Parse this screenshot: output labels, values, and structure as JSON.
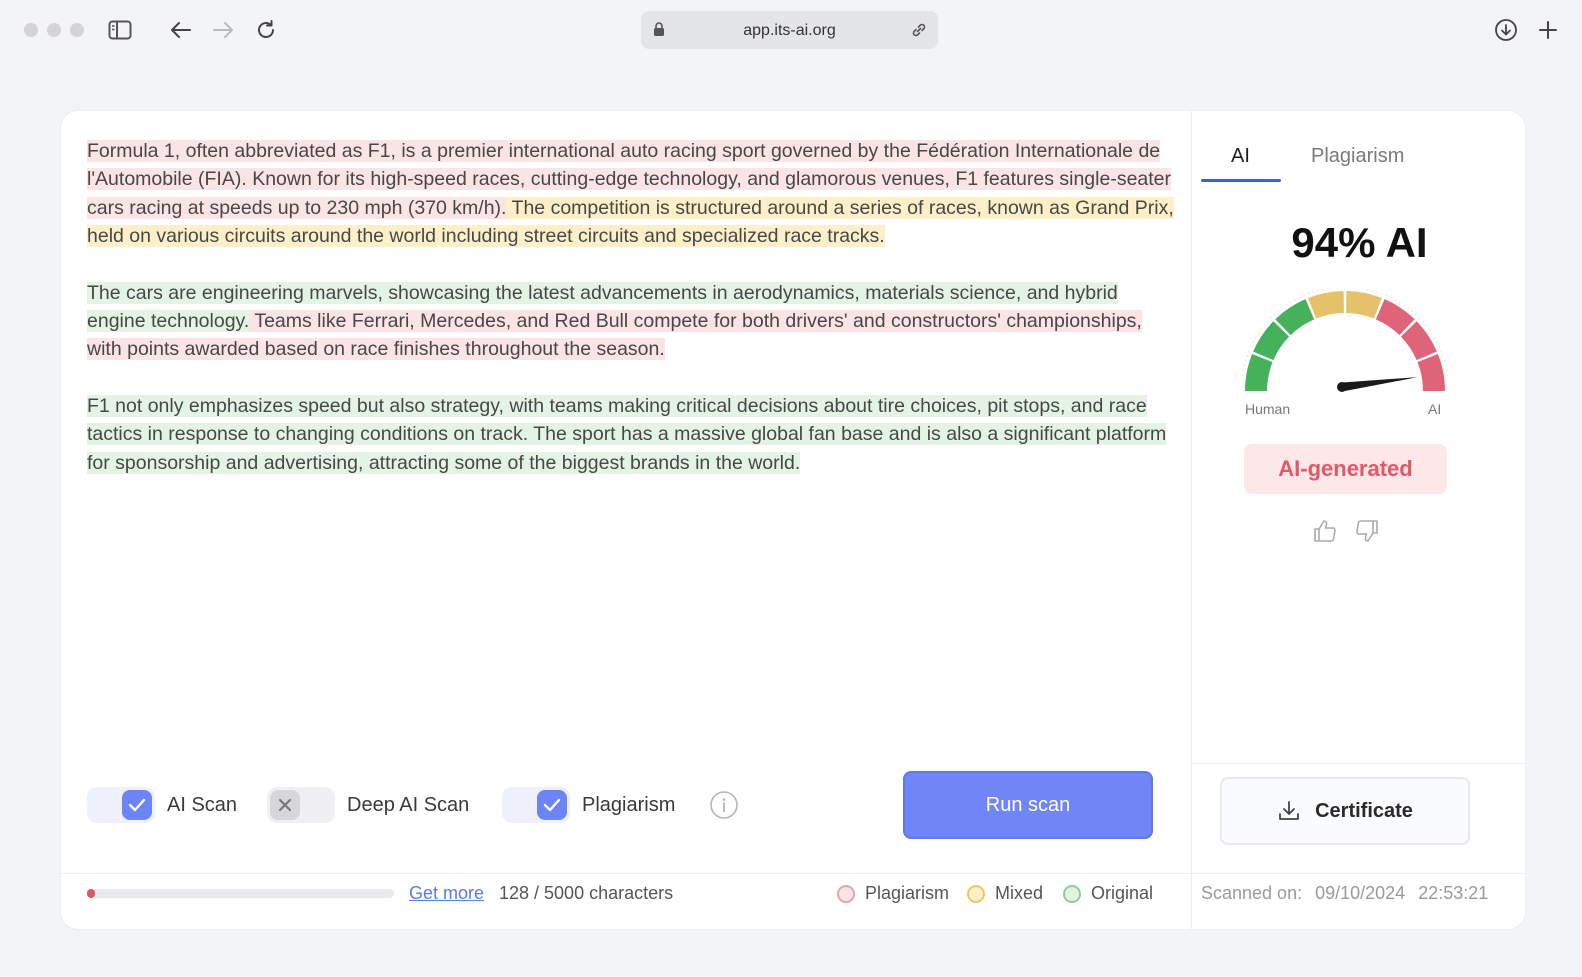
{
  "browser": {
    "url": "app.its-ai.org"
  },
  "editor": {
    "paragraphs": [
      [
        {
          "type": "plagiarism",
          "text": "Formula 1, often abbreviated as F1, is a premier international auto racing sport governed by the Fédération Internationale de l'Automobile (FIA). Known for its high-speed races, cutting-edge technology, and glamorous venues, F1 features single-seater cars racing at speeds up to 230 mph (370 km/h)."
        },
        {
          "type": "mixed",
          "text": " The competition is structured around a series of races, known as Grand Prix, held on various circuits around the world including street circuits and specialized race tracks."
        }
      ],
      [
        {
          "type": "original",
          "text": "The cars are engineering marvels, showcasing the latest advancements in aerodynamics, materials science, and hybrid engine technology."
        },
        {
          "type": "plagiarism",
          "text": " Teams like Ferrari, Mercedes, and Red Bull compete for both drivers' and constructors' championships, with points awarded based on race finishes throughout the season."
        }
      ],
      [
        {
          "type": "original",
          "text": "F1 not only emphasizes speed but also strategy, with teams making critical decisions about tire choices, pit stops, and race tactics in response to changing conditions on track. The sport has a massive global fan base and is also a significant platform for sponsorship and advertising, attracting some of the biggest brands in the world."
        }
      ]
    ]
  },
  "controls": {
    "ai_scan": {
      "label": "AI Scan",
      "checked": true
    },
    "deep_ai_scan": {
      "label": "Deep AI Scan",
      "checked": false
    },
    "plagiarism": {
      "label": "Plagiarism",
      "checked": true
    },
    "run_scan_label": "Run scan"
  },
  "footer": {
    "usage_fraction": 0.0256,
    "get_more_label": "Get more",
    "char_count": "128 / 5000 characters",
    "legend": [
      {
        "label": "Plagiarism",
        "color": "#e8a3ab",
        "fill": "#fbe4e6"
      },
      {
        "label": "Mixed",
        "color": "#f0c66a",
        "fill": "#fdf0c9"
      },
      {
        "label": "Original",
        "color": "#8fcf90",
        "fill": "#e4f4e4"
      }
    ]
  },
  "panel": {
    "tabs": [
      {
        "label": "AI",
        "active": true
      },
      {
        "label": "Plagiarism",
        "active": false
      }
    ],
    "score": "94% AI",
    "gauge": {
      "value": 0.94,
      "min_label": "Human",
      "max_label": "AI"
    },
    "verdict": "AI-generated",
    "certificate_label": "Certificate",
    "scanned_label": "Scanned on:",
    "scanned_date": "09/10/2024",
    "scanned_time": "22:53:21"
  },
  "colors": {
    "accent": "#7086f6",
    "plagiarism": "#fbe4e6",
    "mixed": "#fdf0c9",
    "original": "#e4f4e4",
    "verdict_text": "#e0586a"
  }
}
